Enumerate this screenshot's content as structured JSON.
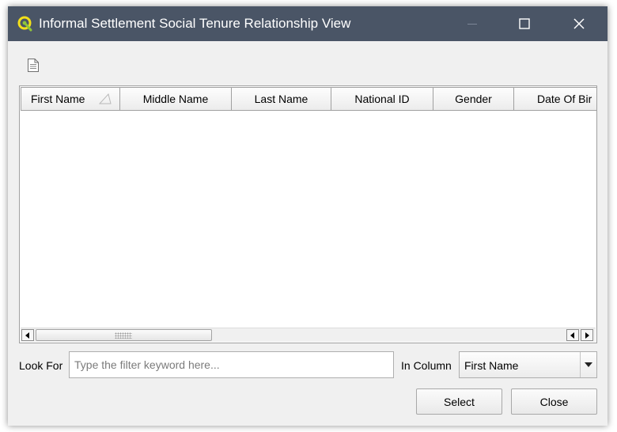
{
  "window": {
    "title": "Informal Settlement Social Tenure Relationship View",
    "title_icon": "qgis-logo-icon",
    "controls": [
      "minimize-icon",
      "maximize-icon",
      "close-icon"
    ]
  },
  "toolbar": {
    "icons": [
      "document-icon"
    ]
  },
  "table": {
    "columns": [
      {
        "label": "First Name",
        "sorted": "ascending"
      },
      {
        "label": "Middle Name"
      },
      {
        "label": "Last Name"
      },
      {
        "label": "National ID"
      },
      {
        "label": "Gender"
      },
      {
        "label": "Date Of Bir"
      }
    ],
    "rows": [],
    "horizontal_scroll_fraction": 0
  },
  "filter": {
    "look_for_label": "Look For",
    "placeholder": "Type the filter keyword here...",
    "value": "",
    "in_column_label": "In Column",
    "column_selected": "First Name"
  },
  "buttons": {
    "select_label": "Select",
    "close_label": "Close"
  },
  "colors": {
    "titlebar": "#4a5566",
    "dialog_background": "#f0f0f0"
  }
}
